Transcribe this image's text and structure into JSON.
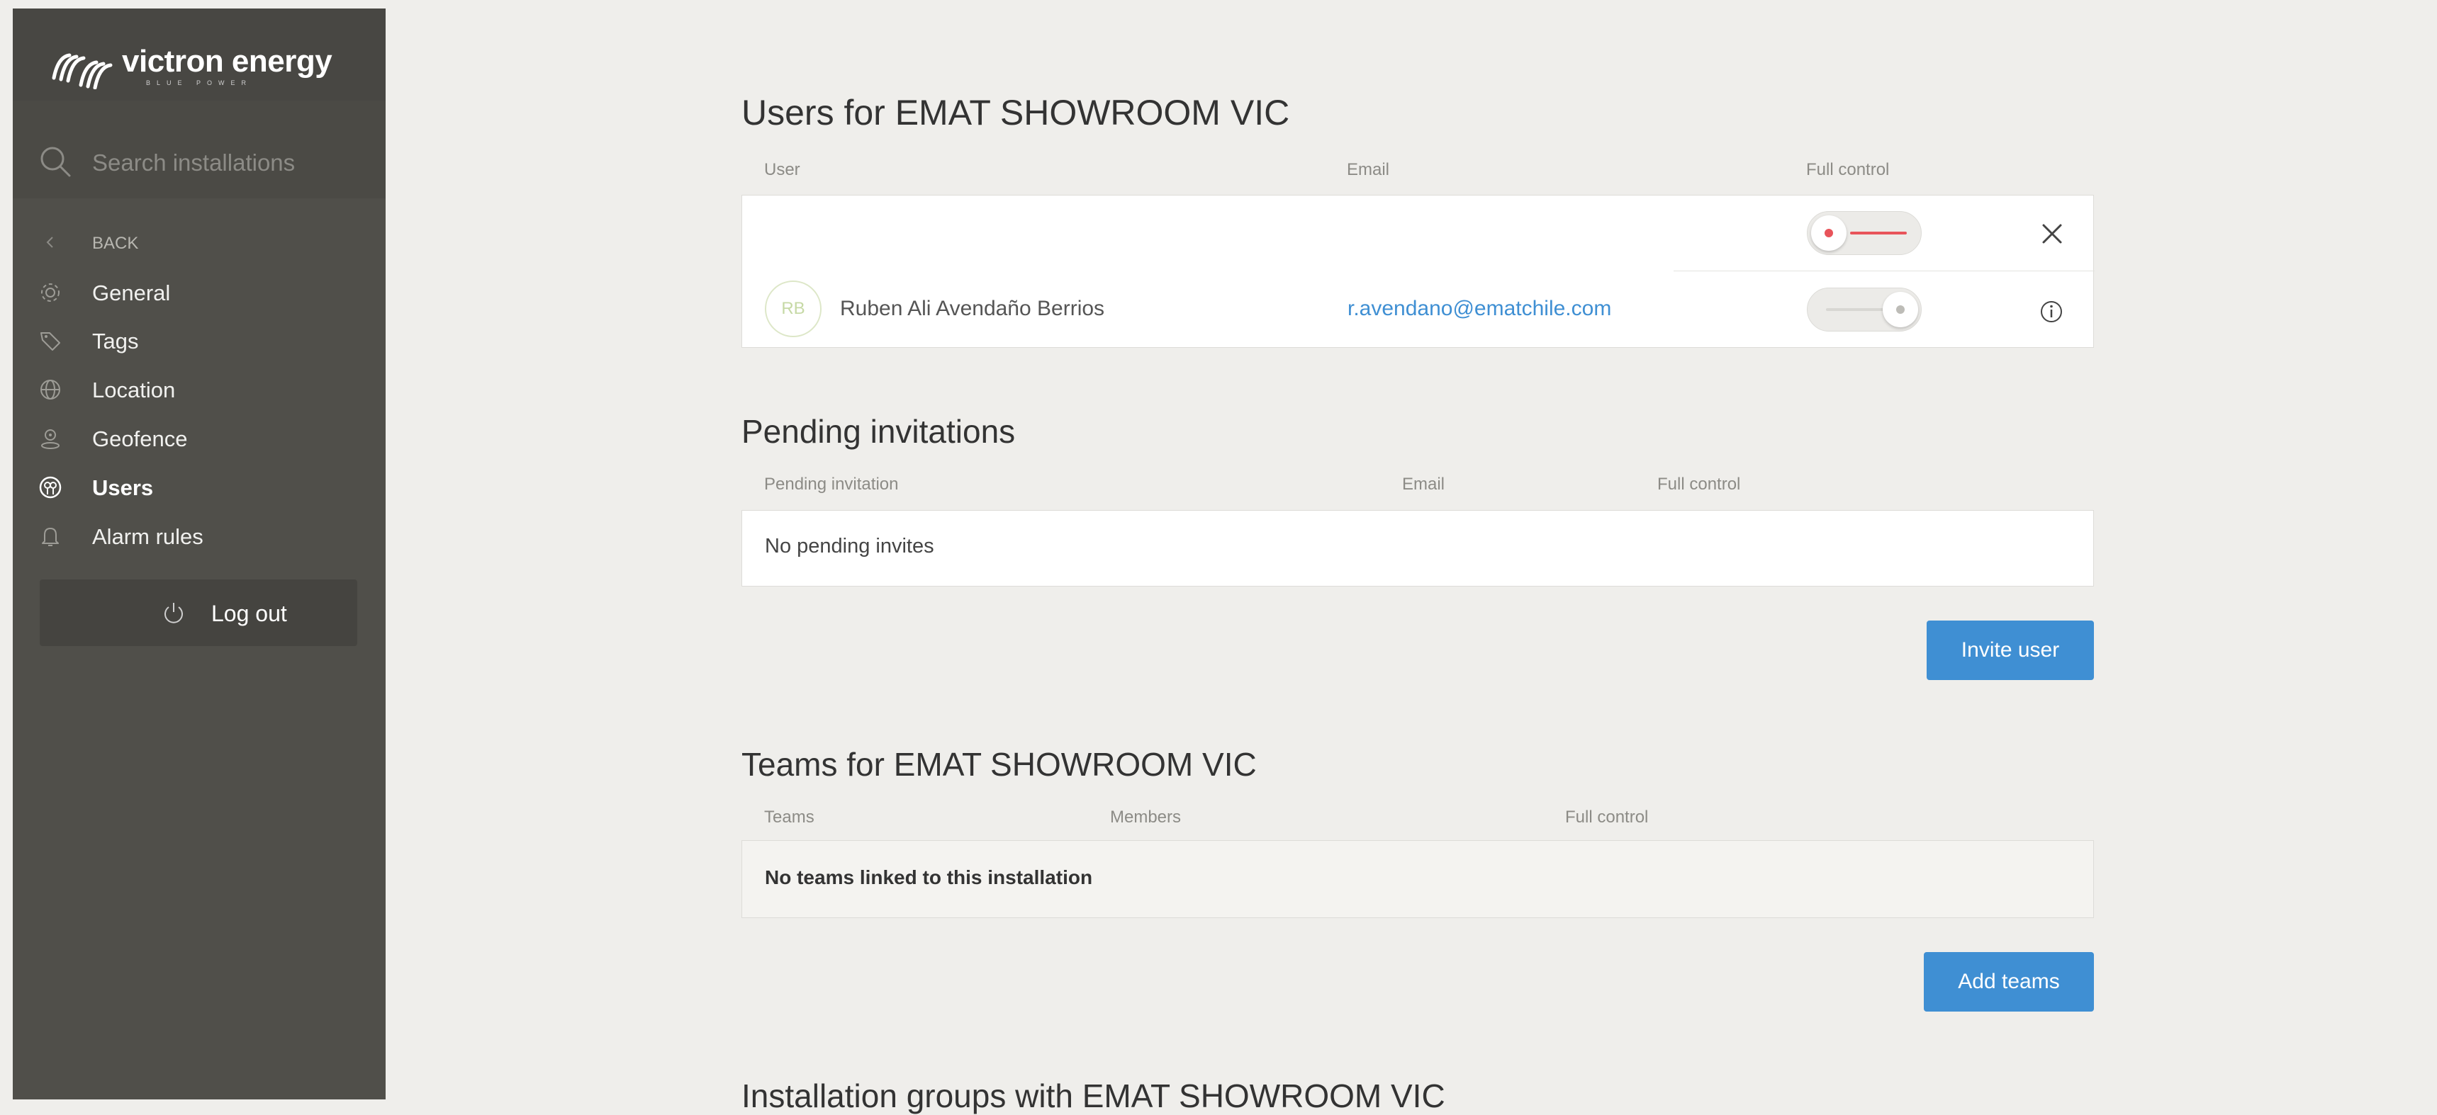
{
  "brand": {
    "name": "victron energy",
    "tagline": "BLUE POWER"
  },
  "search": {
    "placeholder": "Search installations",
    "value": ""
  },
  "sidebar": {
    "back_label": "BACK",
    "items": [
      {
        "label": "General",
        "icon": "gear-icon"
      },
      {
        "label": "Tags",
        "icon": "tag-icon"
      },
      {
        "label": "Location",
        "icon": "globe-icon"
      },
      {
        "label": "Geofence",
        "icon": "geofence-icon"
      },
      {
        "label": "Users",
        "icon": "users-icon",
        "active": true
      },
      {
        "label": "Alarm rules",
        "icon": "bell-icon"
      }
    ],
    "logout_label": "Log out"
  },
  "users_section": {
    "title": "Users for EMAT SHOWROOM VIC",
    "columns": [
      "User",
      "Email",
      "Full control"
    ],
    "rows": [
      {
        "initials": "",
        "name": "",
        "email": "",
        "full_control": false
      },
      {
        "initials": "RB",
        "name": "Ruben Ali Avendaño Berrios",
        "email": "r.avendano@ematchile.com",
        "full_control": true
      }
    ]
  },
  "pending_section": {
    "title": "Pending invitations",
    "columns": [
      "Pending invitation",
      "Email",
      "Full control"
    ],
    "empty_text": "No pending invites",
    "invite_button": "Invite user"
  },
  "teams_section": {
    "title": "Teams for EMAT SHOWROOM VIC",
    "columns": [
      "Teams",
      "Members",
      "Full control"
    ],
    "empty_text": "No teams linked to this installation",
    "add_button": "Add teams"
  },
  "groups_section": {
    "title": "Installation groups with EMAT SHOWROOM VIC"
  },
  "colors": {
    "sidebar_bg": "#504f4a",
    "page_bg": "#efeeeb",
    "accent_blue": "#3f8fd3",
    "toggle_off_red": "#e8545a",
    "avatar_green": "#c6d9a5",
    "link_blue": "#3f8fd3"
  }
}
